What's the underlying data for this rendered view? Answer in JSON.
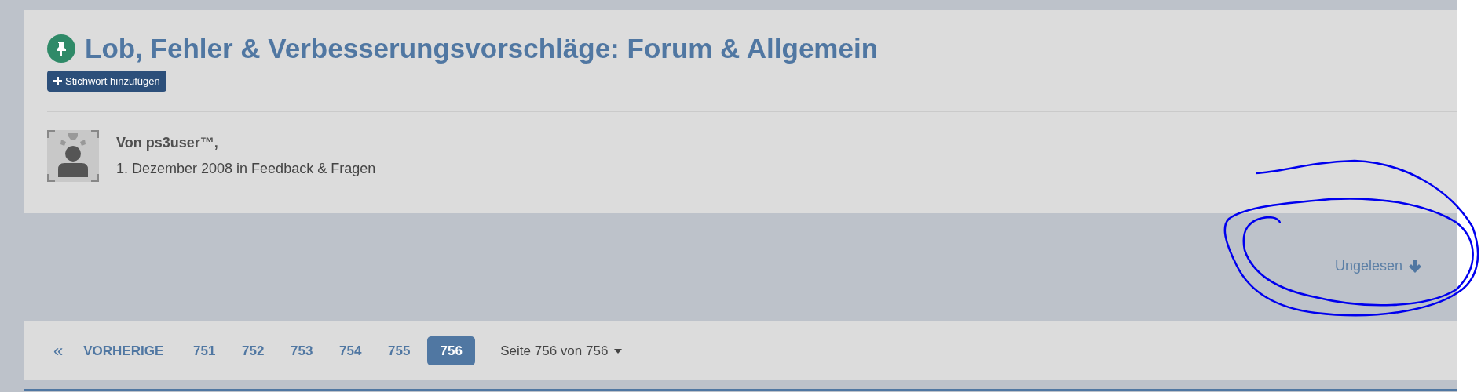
{
  "topic": {
    "pinned": true,
    "title": "Lob, Fehler & Verbesserungsvorschläge: Forum & Allgemein",
    "tag_button": "Stichwort hinzufügen"
  },
  "author": {
    "name": "Von ps3user™,",
    "meta": "1. Dezember 2008 in Feedback & Fragen"
  },
  "unread_link": "Ungelesen",
  "pagination": {
    "first": "«",
    "previous": "VORHERIGE",
    "pages": [
      {
        "label": "751",
        "selected": false
      },
      {
        "label": "752",
        "selected": false
      },
      {
        "label": "753",
        "selected": false
      },
      {
        "label": "754",
        "selected": false
      },
      {
        "label": "755",
        "selected": false
      },
      {
        "label": "756",
        "selected": true
      }
    ],
    "page_info": "Seite 756 von 756"
  }
}
